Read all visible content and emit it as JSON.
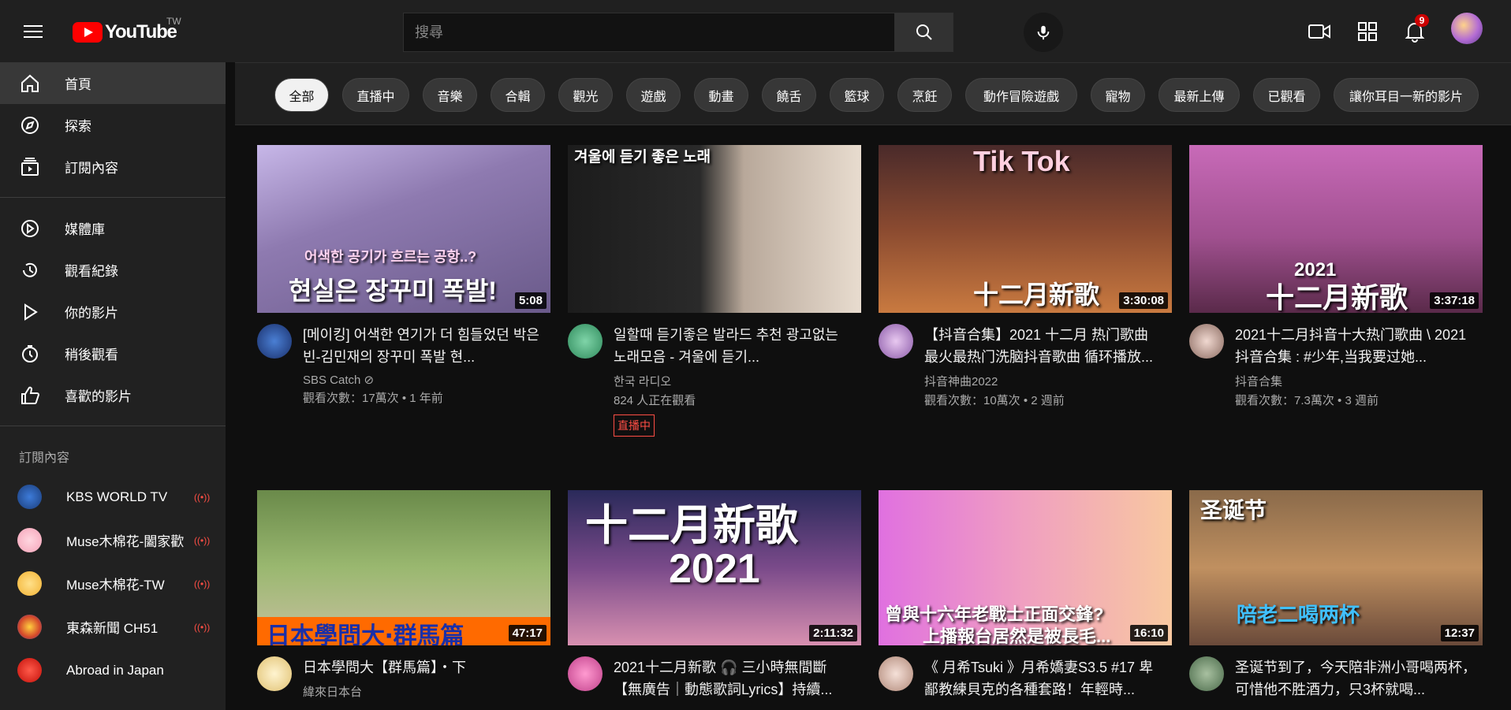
{
  "header": {
    "logo_text": "YouTube",
    "region": "TW",
    "search_placeholder": "搜尋",
    "notification_count": "9"
  },
  "sidebar": {
    "main_items": [
      {
        "label": "首頁",
        "icon": "home-icon"
      },
      {
        "label": "探索",
        "icon": "explore-icon"
      },
      {
        "label": "訂閱內容",
        "icon": "subscriptions-icon"
      }
    ],
    "library_items": [
      {
        "label": "媒體庫",
        "icon": "library-icon"
      },
      {
        "label": "觀看紀錄",
        "icon": "history-icon"
      },
      {
        "label": "你的影片",
        "icon": "your-videos-icon"
      },
      {
        "label": "稍後觀看",
        "icon": "watch-later-icon"
      },
      {
        "label": "喜歡的影片",
        "icon": "liked-videos-icon"
      }
    ],
    "subscriptions_heading": "訂閱內容",
    "subscriptions": [
      {
        "name": "KBS WORLD TV"
      },
      {
        "name": "Muse木棉花-闔家歡"
      },
      {
        "name": "Muse木棉花-TW"
      },
      {
        "name": "東森新聞 CH51"
      },
      {
        "name": "Abroad in Japan"
      }
    ]
  },
  "chips": [
    "全部",
    "直播中",
    "音樂",
    "合輯",
    "觀光",
    "遊戲",
    "動畫",
    "饒舌",
    "籃球",
    "烹飪",
    "動作冒險遊戲",
    "寵物",
    "最新上傳",
    "已觀看",
    "讓你耳目一新的影片"
  ],
  "videos": [
    {
      "title": "[메이킹] 어색한 연기가 더 힘들었던 박은빈-김민재의 장꾸미 폭발 현...",
      "channel": "SBS Catch",
      "views": "觀看次數：17萬次",
      "age": "1 年前",
      "duration": "5:08",
      "thumb_text": "현실은 장꾸미 폭발!",
      "thumb_subtext": "어색한 공기가 흐르는 공항..?"
    },
    {
      "title": "일할때 듣기좋은 발라드 추천 광고없는 노래모음 - 겨울에 듣기...",
      "channel": "한국 라디오",
      "watching": "824 人正在觀看",
      "live_label": "直播中",
      "thumb_text": "겨울에 듣기 좋은 노래"
    },
    {
      "title": "【抖音合集】2021 十二月 热门歌曲 最火最热门洗脑抖音歌曲 循环播放...",
      "channel": "抖音神曲2022",
      "views": "觀看次數：10萬次",
      "age": "2 週前",
      "duration": "3:30:08",
      "thumb_text": "十二月新歌",
      "thumb_subtext": "Tik Tok"
    },
    {
      "title": "2021十二月抖音十大热门歌曲 \\ 2021 抖音合集 : #少年,当我要过她...",
      "channel": "抖音合集",
      "views": "觀看次數：7.3萬次",
      "age": "3 週前",
      "duration": "3:37:18",
      "thumb_text": "十二月新歌",
      "thumb_subtext": "2021"
    },
    {
      "title": "日本學問大【群馬篇】・下",
      "channel": "緯來日本台",
      "duration": "47:17",
      "thumb_text": "日本學問大‧群馬篇"
    },
    {
      "title": "2021十二月新歌 🎧 三小時無間斷【無廣告｜動態歌詞Lyrics】持續...",
      "channel": "",
      "duration": "2:11:32",
      "thumb_text": "十二月新歌",
      "thumb_subtext": "2021"
    },
    {
      "title": "《 月希Tsuki 》月希嬌妻S3.5 #17 卑鄙教練貝克的各種套路！年輕時...",
      "channel": "",
      "duration": "16:10",
      "thumb_text": "曾與十六年老戰士正面交鋒?",
      "thumb_subtext": "上播報台居然是被長毛..."
    },
    {
      "title": "圣诞节到了，今天陪非洲小哥喝两杯，可惜他不胜酒力，只3杯就喝...",
      "channel": "",
      "duration": "12:37",
      "thumb_text": "陪老二喝两杯",
      "thumb_subtext": "圣诞节"
    }
  ],
  "colors": {
    "background": "#0f0f0f",
    "header": "#202020",
    "sidebar": "#212121",
    "accent_red": "#ff0000",
    "live_red": "#ff4e45"
  }
}
